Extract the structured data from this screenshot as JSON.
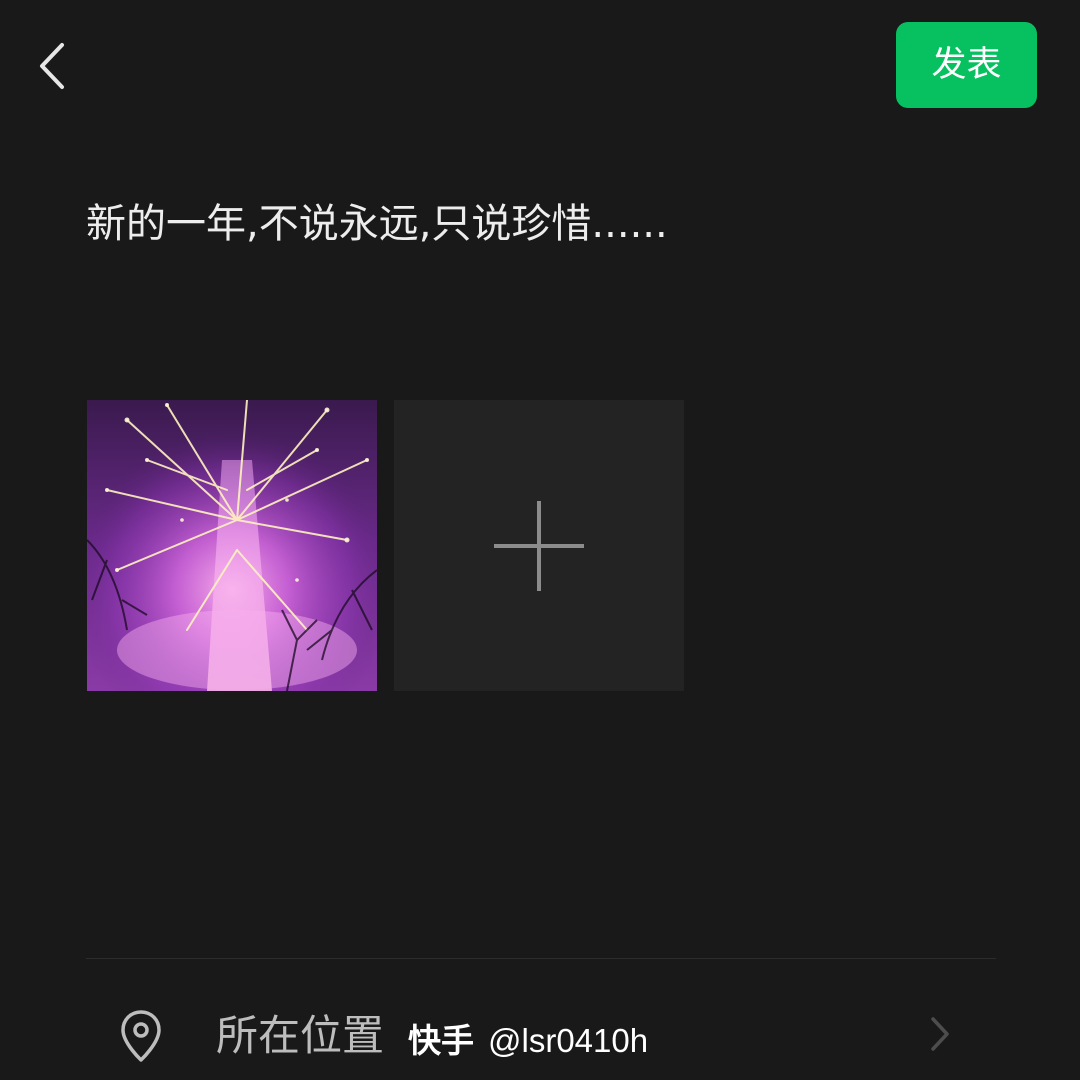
{
  "header": {
    "back_icon": "chevron-left-icon",
    "publish_label": "发表",
    "publish_color": "#07c160"
  },
  "post": {
    "text": "新的一年,不说永远,只说珍惜......"
  },
  "media": {
    "photo_icon": "fireworks-photo",
    "add_icon": "plus-icon"
  },
  "location": {
    "icon": "location-pin-icon",
    "label": "所在位置",
    "chevron_icon": "chevron-right-icon"
  },
  "watermark": {
    "brand": "快手",
    "handle": "@lsr0410h"
  }
}
